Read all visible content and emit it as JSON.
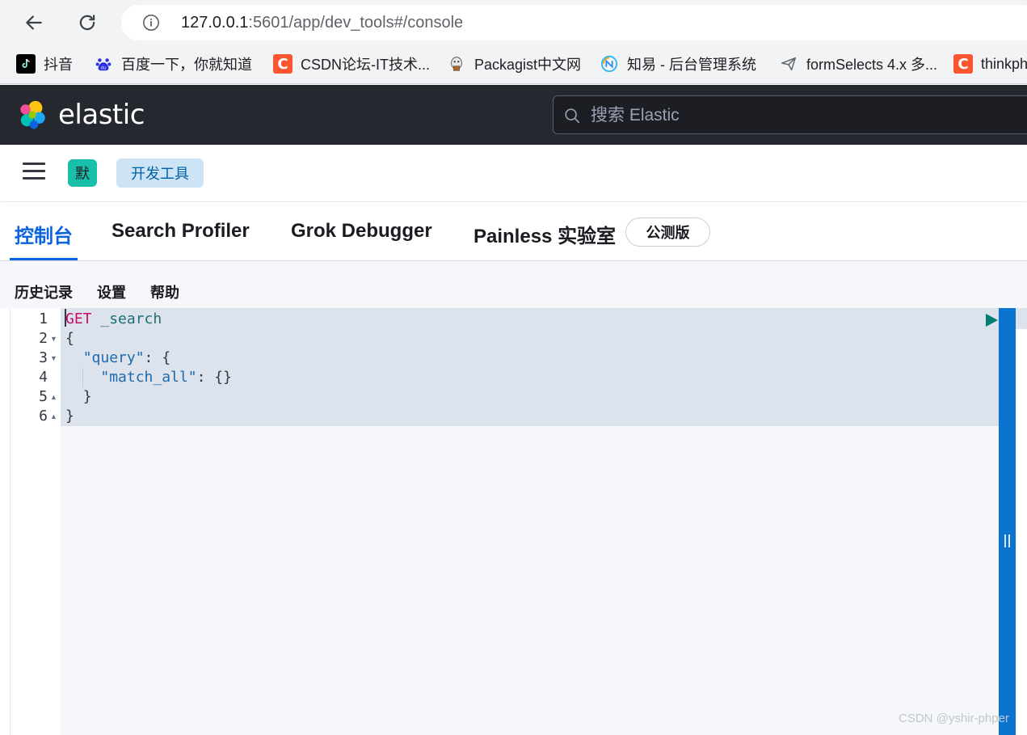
{
  "browser": {
    "url_host": "127.0.0.1",
    "url_rest": ":5601/app/dev_tools#/console",
    "bookmarks": [
      {
        "label": "抖音",
        "icon": "tiktok-icon"
      },
      {
        "label": "百度一下，你就知道",
        "icon": "baidu-paw-icon"
      },
      {
        "label": "CSDN论坛-IT技术...",
        "icon": "csdn-icon"
      },
      {
        "label": "Packagist中文网",
        "icon": "packagist-icon"
      },
      {
        "label": "知易 - 后台管理系统",
        "icon": "zhiyi-icon"
      },
      {
        "label": "formSelects 4.x 多...",
        "icon": "paper-plane-icon"
      },
      {
        "label": "thinkph",
        "icon": "csdn-icon"
      }
    ]
  },
  "header": {
    "brand": "elastic",
    "search_placeholder": "搜索 Elastic"
  },
  "breadcrumbs": {
    "space_initial": "默",
    "current": "开发工具"
  },
  "tabs": [
    {
      "label": "控制台",
      "active": true
    },
    {
      "label": "Search Profiler",
      "active": false
    },
    {
      "label": "Grok Debugger",
      "active": false
    },
    {
      "label": "Painless 实验室",
      "active": false
    }
  ],
  "beta_badge": "公测版",
  "subnav": [
    "历史记录",
    "设置",
    "帮助"
  ],
  "editor": {
    "line_numbers": [
      "1",
      "2",
      "3",
      "4",
      "5",
      "6"
    ],
    "lines": {
      "l1_method": "GET",
      "l1_url": " _search",
      "l2": "{",
      "l3_key": "\"query\"",
      "l3_rest": ": {",
      "l4_key": "\"match_all\"",
      "l4_rest": ": {}",
      "l5": "}",
      "l6": "}"
    }
  },
  "watermark": "CSDN @yshir-phper",
  "colors": {
    "header_bg": "#25282f",
    "accent": "#0b64dd",
    "resizer": "#0b74d0",
    "space_avatar": "#19bfa9"
  }
}
